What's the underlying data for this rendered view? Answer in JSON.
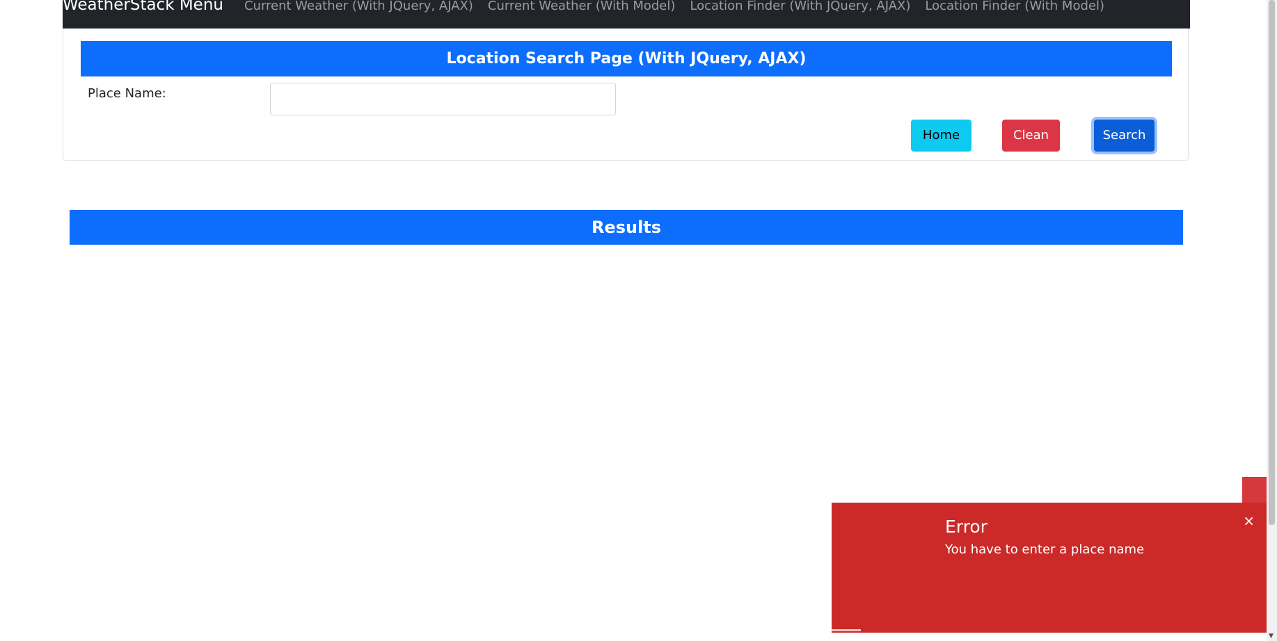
{
  "navbar": {
    "brand": "WeatherStack Menu",
    "links": [
      "Current Weather (With JQuery, AJAX)",
      "Current Weather (With Model)",
      "Location Finder (With JQuery, AJAX)",
      "Location Finder (With Model)"
    ]
  },
  "search": {
    "title": "Location Search Page (With JQuery, AJAX)",
    "place_label": "Place Name:",
    "place_value": "",
    "home_label": "Home",
    "clean_label": "Clean",
    "search_label": "Search"
  },
  "results": {
    "title": "Results"
  },
  "toast": {
    "title": "Error",
    "message": "You have to enter a place name",
    "close_icon": "×"
  },
  "colors": {
    "navbar": "#212529",
    "primary": "#0d6efd",
    "info": "#0dcaf0",
    "danger": "#dc3545",
    "toast": "#cb2a28"
  }
}
